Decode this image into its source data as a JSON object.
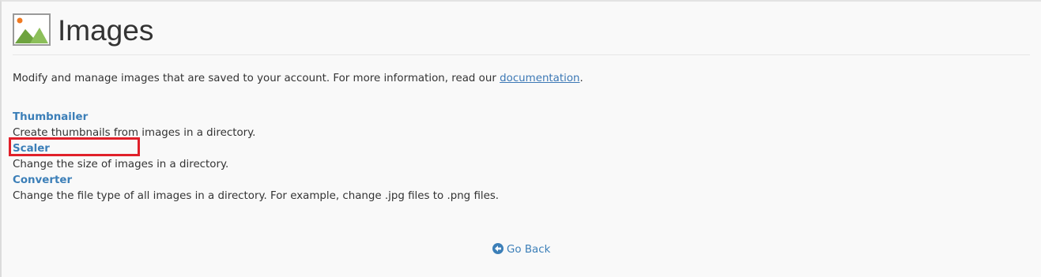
{
  "header": {
    "title": "Images",
    "icon": "images-icon"
  },
  "intro": {
    "text": "Modify and manage images that are saved to your account. For more information, read our ",
    "link_label": "documentation",
    "suffix": "."
  },
  "features": [
    {
      "label": "Thumbnailer",
      "description": "Create thumbnails from images in a directory."
    },
    {
      "label": "Scaler",
      "description": "Change the size of images in a directory."
    },
    {
      "label": "Converter",
      "description": "Change the file type of all images in a directory. For example, change .jpg files to .png files."
    }
  ],
  "footer": {
    "go_back_label": "Go Back",
    "go_back_icon": "arrow-circle-left-icon"
  },
  "colors": {
    "link": "#3c7fb8",
    "highlight": "#e0202a",
    "background": "#f9f9f9",
    "text": "#333333"
  }
}
